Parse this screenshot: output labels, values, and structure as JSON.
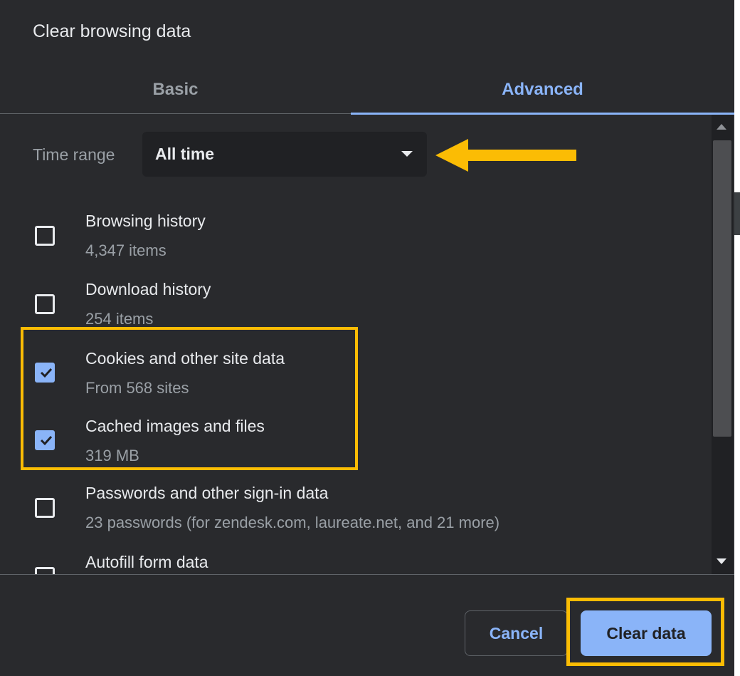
{
  "dialog": {
    "title": "Clear browsing data"
  },
  "tabs": [
    {
      "label": "Basic",
      "active": false
    },
    {
      "label": "Advanced",
      "active": true
    }
  ],
  "time_range": {
    "label": "Time range",
    "selected": "All time"
  },
  "items": [
    {
      "title": "Browsing history",
      "subtitle": "4,347 items",
      "checked": false
    },
    {
      "title": "Download history",
      "subtitle": "254 items",
      "checked": false
    },
    {
      "title": "Cookies and other site data",
      "subtitle": "From 568 sites",
      "checked": true
    },
    {
      "title": "Cached images and files",
      "subtitle": "319 MB",
      "checked": true
    },
    {
      "title": "Passwords and other sign-in data",
      "subtitle": "23 passwords (for zendesk.com, laureate.net, and 21 more)",
      "checked": false
    },
    {
      "title": "Autofill form data",
      "subtitle": "",
      "checked": false
    }
  ],
  "footer": {
    "cancel_label": "Cancel",
    "clear_label": "Clear data"
  },
  "colors": {
    "background": "#292a2d",
    "accent": "#8ab4f8",
    "annotation": "#fbbc04"
  }
}
